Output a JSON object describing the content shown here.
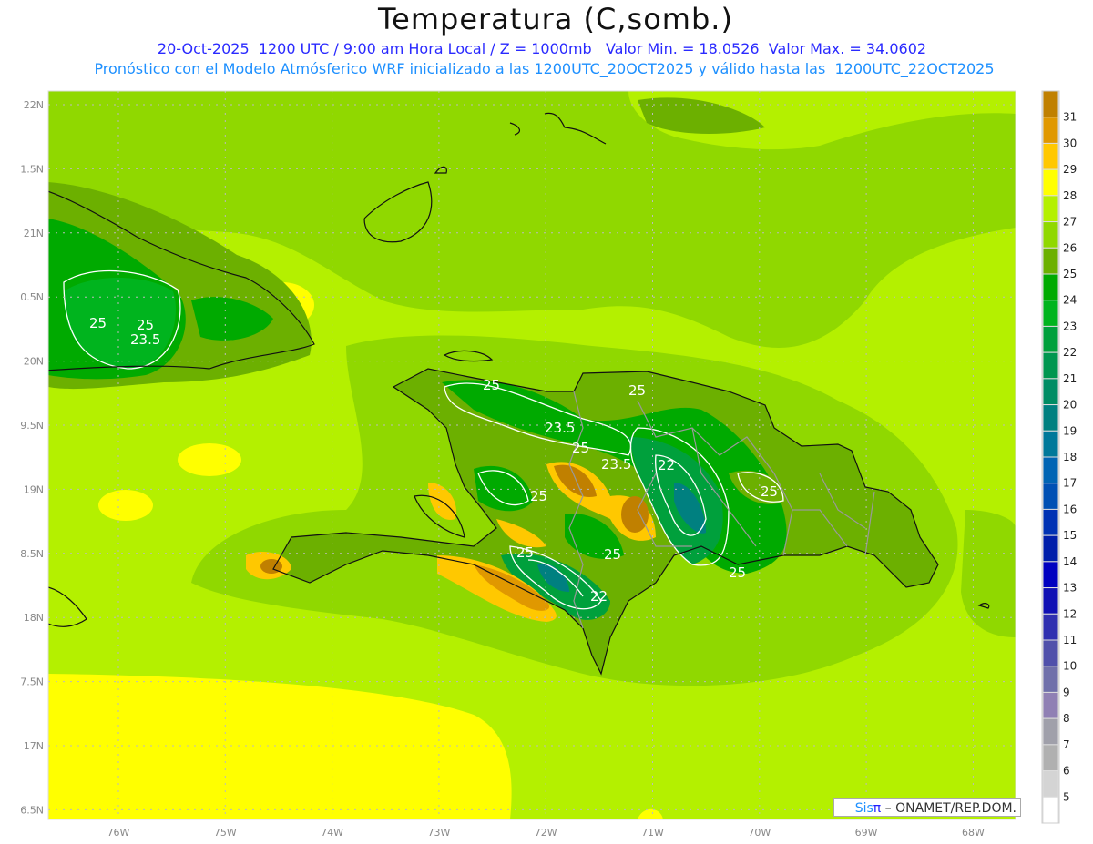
{
  "header": {
    "title": "Temperatura (C,somb.)",
    "subtitle_line1": "20-Oct-2025  1200 UTC / 9:00 am Hora Local / Z = 1000mb   Valor Min. = 18.0526  Valor Max. = 34.0602",
    "subtitle_line2": "Pronóstico con el Modelo Atmósferico WRF inicializado a las 1200UTC_20OCT2025 y válido hasta las  1200UTC_22OCT2025"
  },
  "axes": {
    "lat_labels": [
      "22N",
      "1.5N",
      "21N",
      "0.5N",
      "20N",
      "9.5N",
      "19N",
      "8.5N",
      "18N",
      "7.5N",
      "17N",
      "6.5N"
    ],
    "lon_labels": [
      "76W",
      "75W",
      "74W",
      "73W",
      "72W",
      "71W",
      "70W",
      "69W",
      "68W"
    ]
  },
  "colorbar": {
    "labels": [
      "31",
      "30",
      "29",
      "28",
      "27",
      "26",
      "25",
      "24",
      "23",
      "22",
      "21",
      "20",
      "19",
      "18",
      "17",
      "16",
      "15",
      "14",
      "13",
      "12",
      "11",
      "10",
      "9",
      "8",
      "7",
      "6",
      "5"
    ],
    "colors": [
      "#c08000",
      "#e09800",
      "#ffc800",
      "#ffff00",
      "#b4f000",
      "#90d800",
      "#6cb000",
      "#00aa00",
      "#00b41e",
      "#00a03c",
      "#009650",
      "#008c64",
      "#008080",
      "#00789a",
      "#0064b4",
      "#0050b4",
      "#0032b4",
      "#001eaa",
      "#0000c0",
      "#1010b4",
      "#3030b0",
      "#5050aa",
      "#7070aa",
      "#9080b4",
      "#a0a0aa",
      "#b0b0b0",
      "#d4d4d4",
      "#ffffff"
    ]
  },
  "contour_labels": [
    "25",
    "25",
    "23.5",
    "25",
    "23.5",
    "25",
    "25",
    "23.5",
    "22",
    "25",
    "25",
    "25",
    "25",
    "22",
    "25"
  ],
  "logo": {
    "sis": "Sis",
    "pi": "π",
    "rest": " – ONAMET/REP.DOM."
  }
}
